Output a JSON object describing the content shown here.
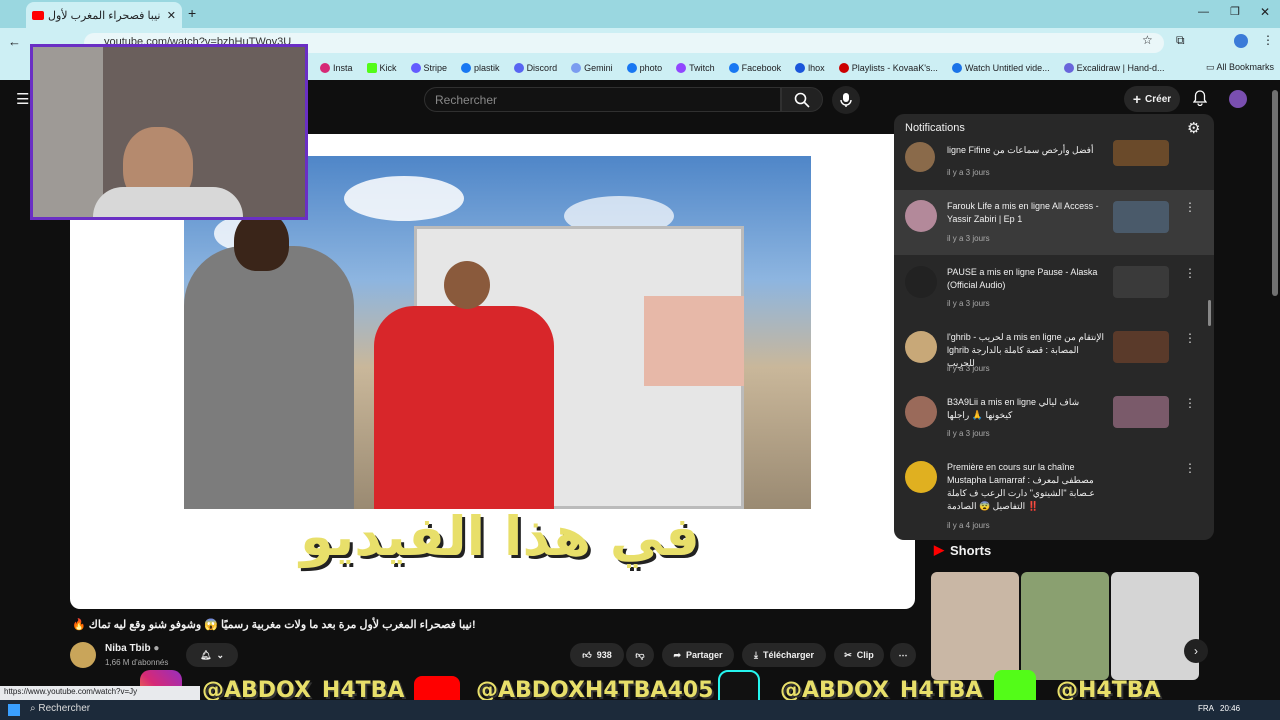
{
  "browser": {
    "tab_title": "نيبا فصحراء المغرب لأول",
    "url": "youtube.com/watch?v=bzhHuTWoy3U",
    "bookmarks": [
      "Insta",
      "Kick",
      "Stripe",
      "plastik",
      "Discord",
      "Gemini",
      "photo",
      "Twitch",
      "Facebook",
      "lhox",
      "Playlists - KovaaK's...",
      "Watch Untitled vide...",
      "Excalidraw | Hand-d..."
    ],
    "all_bookmarks": "All Bookmarks",
    "status_url": "https://www.youtube.com/watch?v=Jy"
  },
  "header": {
    "search_placeholder": "Rechercher",
    "create_label": "Créer"
  },
  "video": {
    "overlay_arabic": "في هذا الفيديو",
    "title": "!نيبا فصحراء المغرب لأول مرة بعد ما ولات مغربية رسميًا 😱 وشوفو شنو وقع ليه تماك 🔥",
    "channel_name": "Niba Tbib",
    "subscribers": "1,66 M d'abonnés",
    "likes": "938",
    "share_label": "Partager",
    "download_label": "Télécharger",
    "clip_label": "Clip"
  },
  "notifications": {
    "title": "Notifications",
    "items": [
      {
        "text": "ligne Fifine أفضل وأرخص سماعات من",
        "time": "il y a 3 jours"
      },
      {
        "text": "Farouk Life a mis en ligne All Access - Yassir Zabiri | Ep 1",
        "time": "il y a 3 jours"
      },
      {
        "text": "PAUSE a mis en ligne Pause - Alaska (Official Audio)",
        "time": "il y a 3 jours"
      },
      {
        "text": "l'ghrib - لحريب a mis en ligne الإنتقام من lghrib المصابة : قصة كاملة بالدارجة للحريب",
        "time": "il y a 3 jours"
      },
      {
        "text": "B3A9Lii a mis en ligne شاف ليالي كيخونها 🙏 راجلها",
        "time": "il y a 3 jours"
      },
      {
        "text": "Première en cours sur la chaîne Mustapha Lamarraf : مصطفى لمعرف عـصابة \"الشيتوي\" دارت الرعب ف كاملة ‼️ التفاصيل 😨 الصادمة",
        "time": "il y a 4 jours"
      }
    ]
  },
  "shorts": {
    "title": "Shorts"
  },
  "stream_overlay": {
    "instagram": "@ABDOX_H4TBA",
    "youtube": "@ABDOXH4TBA405",
    "tiktok": "@ABDOX_H4TBA",
    "kick": "@H4TBA"
  },
  "taskbar": {
    "search_label": "Rechercher",
    "language": "FRA",
    "time": "20:46"
  },
  "colors": {
    "youtube_red": "#ff0000",
    "overlay_yellow": "#e8df6a",
    "webcam_border": "#6a2fc4"
  }
}
